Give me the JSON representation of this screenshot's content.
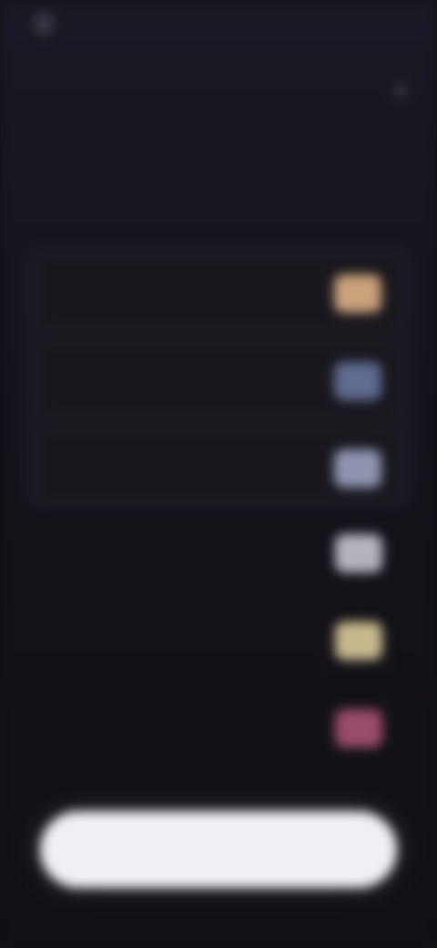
{
  "app": {
    "brand": ""
  },
  "header": {
    "close_glyph": "✕"
  },
  "main": {
    "title": "",
    "subtitle": ""
  },
  "options": [
    {
      "label": "",
      "thumb_color": "#caa27c"
    },
    {
      "label": "",
      "thumb_color": "#5f6b8f"
    },
    {
      "label": "",
      "thumb_color": "#8f95b0"
    },
    {
      "label": "",
      "thumb_color": "#b7b3bd"
    },
    {
      "label": "",
      "thumb_color": "#c6b98e"
    },
    {
      "label": "",
      "thumb_color": "#9a4b6a"
    }
  ],
  "cta": {
    "label": ""
  },
  "colors": {
    "background": "#121016",
    "card_border": "#3a3644",
    "button_bg": "#f2eff4"
  }
}
